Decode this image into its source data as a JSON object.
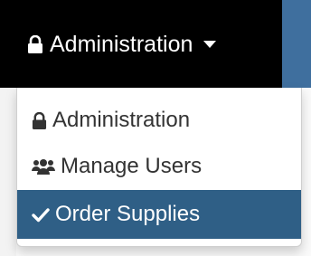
{
  "navbar": {
    "toggle_label": "Administration",
    "icon": "lock-icon",
    "caret_icon": "caret-down-icon",
    "background": "#000000",
    "accent": "#3f6f9e"
  },
  "dropdown": {
    "items": [
      {
        "label": "Administration",
        "icon": "lock-icon",
        "selected": false
      },
      {
        "label": "Manage Users",
        "icon": "users-icon",
        "selected": false
      },
      {
        "label": "Order Supplies",
        "icon": "checkmark-icon",
        "selected": true
      }
    ],
    "selected_background": "#2f5f86"
  }
}
